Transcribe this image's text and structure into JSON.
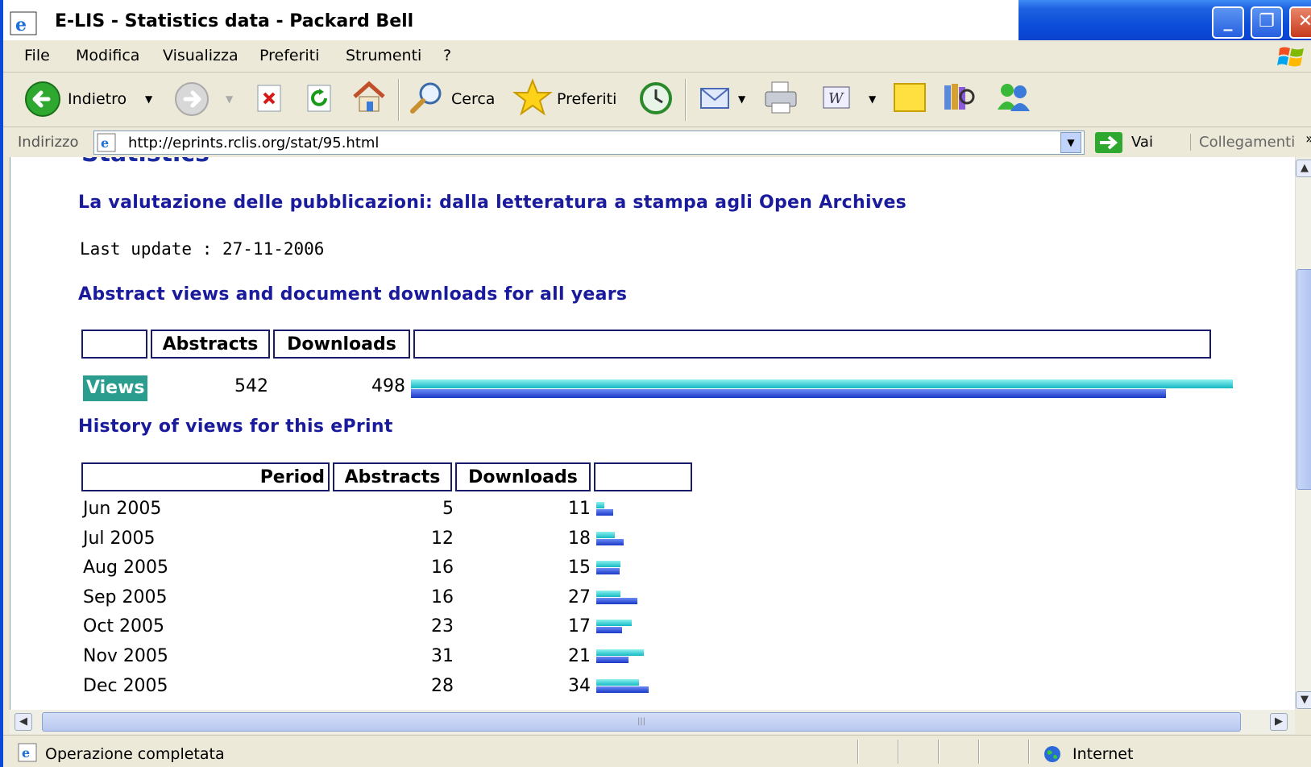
{
  "window": {
    "title": "E-LIS - Statistics data - Packard Bell",
    "minimize": "_",
    "maximize": "❐",
    "close": "✕"
  },
  "menu": [
    "File",
    "Modifica",
    "Visualizza",
    "Preferiti",
    "Strumenti",
    "?"
  ],
  "toolbar": {
    "back": "Indietro",
    "search": "Cerca",
    "favorites": "Preferiti"
  },
  "address": {
    "label": "Indirizzo",
    "url": "http://eprints.rclis.org/stat/95.html",
    "go": "Vai",
    "links": "Collegamenti",
    "links_more": "»"
  },
  "page": {
    "heading": "Statistics",
    "eprint_title": "La valutazione delle pubblicazioni: dalla letteratura a stampa agli Open Archives",
    "last_update": "Last update : 27-11-2006",
    "all_years_heading": "Abstract views and document downloads for all years",
    "totals": {
      "col_abstracts": "Abstracts",
      "col_downloads": "Downloads",
      "row_label": "Views",
      "abstracts": "542",
      "downloads": "498",
      "abstracts_value": 542,
      "downloads_value": 498
    },
    "history_heading": "History of views for this ePrint",
    "history": {
      "col_period": "Period",
      "col_abstracts": "Abstracts",
      "col_downloads": "Downloads",
      "rows": [
        {
          "period": "Jun 2005",
          "abstracts": "5",
          "downloads": "11",
          "a": 5,
          "d": 11
        },
        {
          "period": "Jul 2005",
          "abstracts": "12",
          "downloads": "18",
          "a": 12,
          "d": 18
        },
        {
          "period": "Aug 2005",
          "abstracts": "16",
          "downloads": "15",
          "a": 16,
          "d": 15
        },
        {
          "period": "Sep 2005",
          "abstracts": "16",
          "downloads": "27",
          "a": 16,
          "d": 27
        },
        {
          "period": "Oct 2005",
          "abstracts": "23",
          "downloads": "17",
          "a": 23,
          "d": 17
        },
        {
          "period": "Nov 2005",
          "abstracts": "31",
          "downloads": "21",
          "a": 31,
          "d": 21
        },
        {
          "period": "Dec 2005",
          "abstracts": "28",
          "downloads": "34",
          "a": 28,
          "d": 34
        }
      ]
    }
  },
  "statusbar": {
    "text": "Operazione completata",
    "zone": "Internet"
  },
  "colors": {
    "abstract_bar": "#14b8c4",
    "download_bar": "#1838c8",
    "heading": "#1a1a9c",
    "views_badge": "#2a9d8f"
  }
}
